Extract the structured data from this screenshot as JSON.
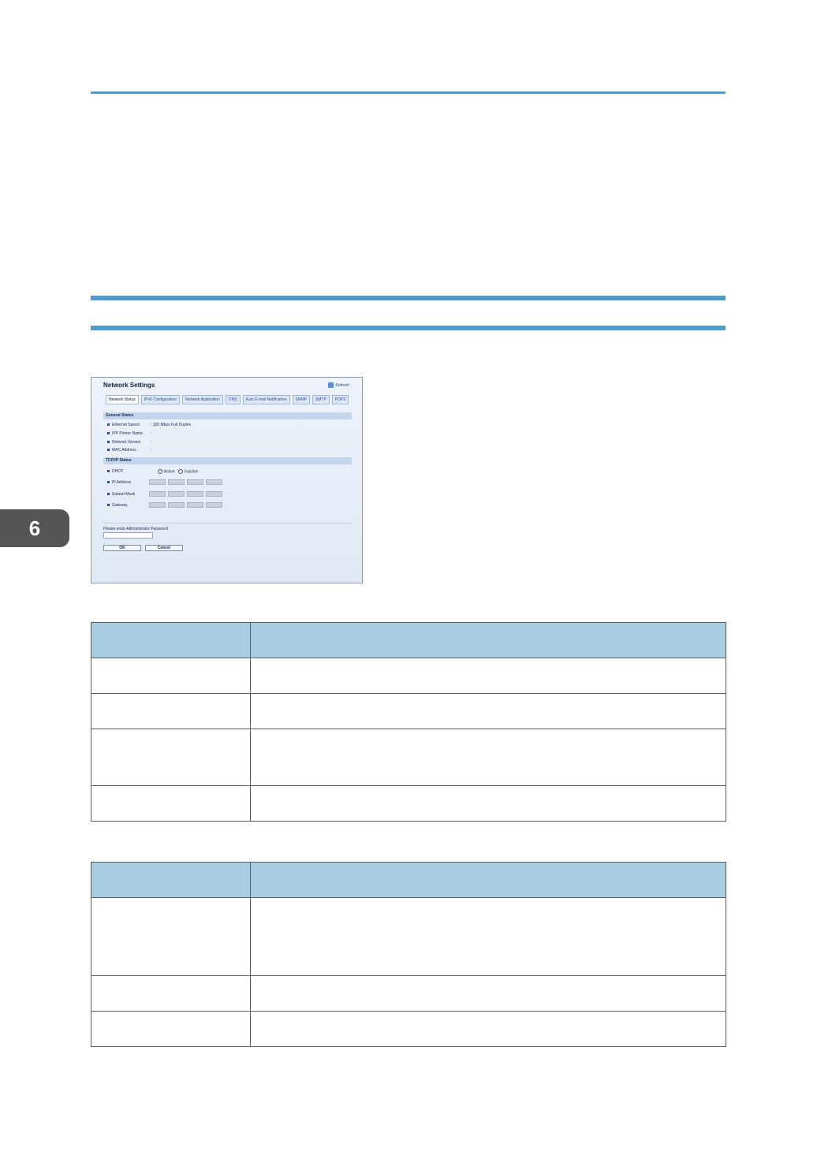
{
  "chapter": {
    "number": "6"
  },
  "screenshot": {
    "title": "Network Settings",
    "refresh": "Refresh",
    "tabs": [
      "Network Status",
      "IPv6 Configuration",
      "Network Application",
      "DNS",
      "Auto E-mail Notification",
      "SNMP",
      "SMTP",
      "POP3"
    ],
    "general_status": {
      "heading": "General Status",
      "rows": [
        {
          "label": "Ethernet Speed",
          "value": ": 100 Mbps Full Duplex"
        },
        {
          "label": "IPP Printer Name",
          "value": ":"
        },
        {
          "label": "Network Version",
          "value": ":"
        },
        {
          "label": "MAC Address",
          "value": ":"
        }
      ]
    },
    "tcpip_status": {
      "heading": "TCP/IP Status",
      "dhcp_label": "DHCP",
      "dhcp_active": "Active",
      "dhcp_inactive": "Inactive",
      "ip_label": "IP Address",
      "subnet_label": "Subnet Mask",
      "gateway_label": "Gateway"
    },
    "password_label": "Please enter Administrator Password",
    "ok": "OK",
    "cancel": "Cancel"
  }
}
